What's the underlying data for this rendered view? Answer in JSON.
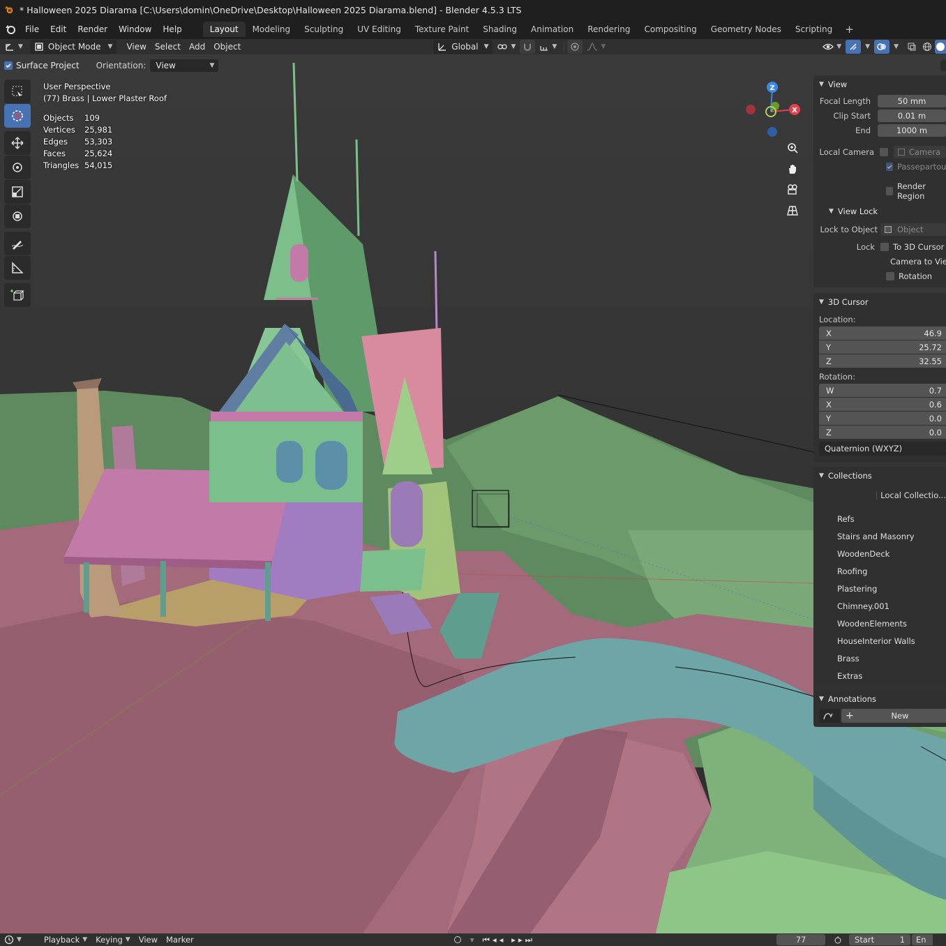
{
  "window": {
    "title": "* Halloween 2025 Diarama [C:\\Users\\domin\\OneDrive\\Desktop\\Halloween 2025 Diarama.blend] - Blender 4.5.3 LTS"
  },
  "menu": [
    "File",
    "Edit",
    "Render",
    "Window",
    "Help"
  ],
  "workspaces": {
    "active": "Layout",
    "tabs": [
      "Layout",
      "Modeling",
      "Sculpting",
      "UV Editing",
      "Texture Paint",
      "Shading",
      "Animation",
      "Rendering",
      "Compositing",
      "Geometry Nodes",
      "Scripting"
    ],
    "add_label": "+"
  },
  "viewport_header": {
    "mode": "Object Mode",
    "menus": [
      "View",
      "Select",
      "Add",
      "Object"
    ],
    "transform_orientation": "Global"
  },
  "tool_settings": {
    "surface_project_label": "Surface Project",
    "surface_project_checked": true,
    "orientation_label": "Orientation:",
    "orientation_value": "View"
  },
  "overlay": {
    "view_name": "User Perspective",
    "active_object": "(77) Brass | Lower Plaster Roof",
    "stats": [
      {
        "label": "Objects",
        "value": "109"
      },
      {
        "label": "Vertices",
        "value": "25,981"
      },
      {
        "label": "Edges",
        "value": "53,303"
      },
      {
        "label": "Faces",
        "value": "25,624"
      },
      {
        "label": "Triangles",
        "value": "54,015"
      }
    ]
  },
  "gizmo": {
    "x_label": "X",
    "y_label": "Y",
    "z_label": "Z",
    "x_color": "#e2414d",
    "y_color": "#84bc3a",
    "z_color": "#3d88e0"
  },
  "sidebar": {
    "view_panel": {
      "title": "View",
      "focal_length_label": "Focal Length",
      "focal_length": "50 mm",
      "clip_start_label": "Clip Start",
      "clip_start": "0.01 m",
      "clip_end_label": "End",
      "clip_end": "1000 m",
      "local_camera_label": "Local Camera",
      "camera_placeholder": "Camera",
      "passepartout_label": "Passepartout",
      "render_region_label": "Render Region"
    },
    "view_lock": {
      "title": "View Lock",
      "lock_to_object_label": "Lock to Object",
      "lock_object_placeholder": "Object",
      "lock_label": "Lock",
      "to_3d_cursor": "To 3D Cursor",
      "camera_to_view": "Camera to View",
      "rotation": "Rotation"
    },
    "cursor": {
      "title": "3D Cursor",
      "location_label": "Location:",
      "location": [
        {
          "axis": "X",
          "value": "46.9"
        },
        {
          "axis": "Y",
          "value": "25.72"
        },
        {
          "axis": "Z",
          "value": "32.55"
        }
      ],
      "rotation_label": "Rotation:",
      "rotation": [
        {
          "axis": "W",
          "value": "0.7"
        },
        {
          "axis": "X",
          "value": "0.6"
        },
        {
          "axis": "Y",
          "value": "0.0"
        },
        {
          "axis": "Z",
          "value": "0.0"
        }
      ],
      "rotation_mode": "Quaternion (WXYZ)"
    },
    "collections": {
      "title": "Collections",
      "local_label": "Local Collectio...",
      "items": [
        "Refs",
        "Stairs and Masonry",
        "WoodenDeck",
        "Roofing",
        "Plastering",
        "Chimney.001",
        "WoodenElements",
        "HouseInterior Walls",
        "Brass",
        "Extras"
      ]
    },
    "annotations": {
      "title": "Annotations",
      "new_label": "New"
    }
  },
  "timeline": {
    "menus": [
      "Playback",
      "Keying",
      "View",
      "Marker"
    ],
    "current_frame": "77",
    "start_label": "Start",
    "start": "1",
    "end_label": "En"
  }
}
